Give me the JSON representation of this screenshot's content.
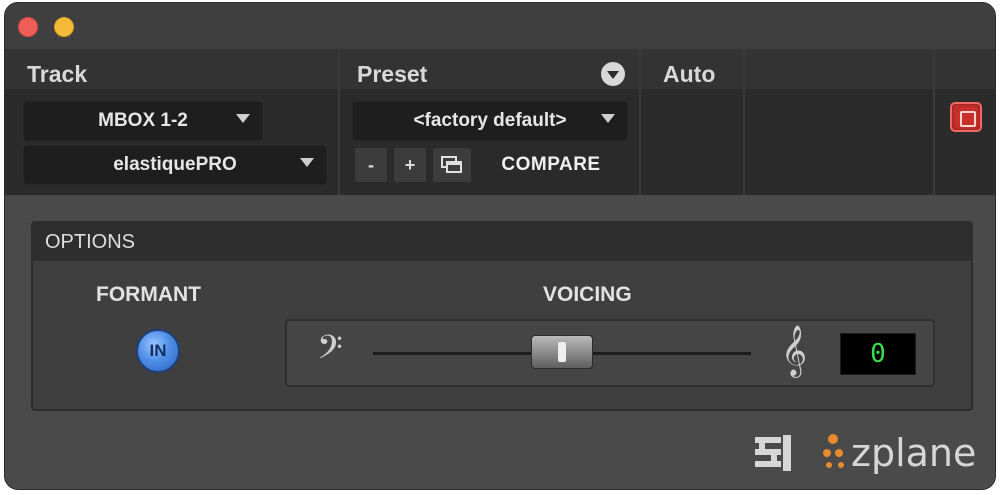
{
  "window": {
    "controls": [
      "close",
      "minimize"
    ]
  },
  "header": {
    "track_label": "Track",
    "preset_label": "Preset",
    "auto_label": "Auto",
    "track_input": "MBOX 1-2",
    "track_algorithm": "elastiquePRO",
    "preset_value": "<factory default>",
    "preset_minus": "-",
    "preset_plus": "+",
    "compare_label": "COMPARE",
    "preset_menu_icon": "chevron-circle-down-icon",
    "bypass_icon": "bypass-icon"
  },
  "options": {
    "title": "OPTIONS",
    "formant_label": "FORMANT",
    "formant_button": "IN",
    "voicing_label": "VOICING",
    "voicing_value": "0",
    "voicing_slider_level": 0.5,
    "bass_clef_icon": "bass-clef-icon",
    "treble_clef_icon": "treble-clef-icon"
  },
  "branding": {
    "zplane_text": "zplane",
    "elastique_logo": "elastique-logo",
    "zplane_logo": "zplane-logo"
  },
  "colors": {
    "accent_blue": "#4f8fe8",
    "bypass_red": "#c9302c",
    "readout_green": "#39e04a",
    "zplane_orange": "#e88a2e"
  }
}
